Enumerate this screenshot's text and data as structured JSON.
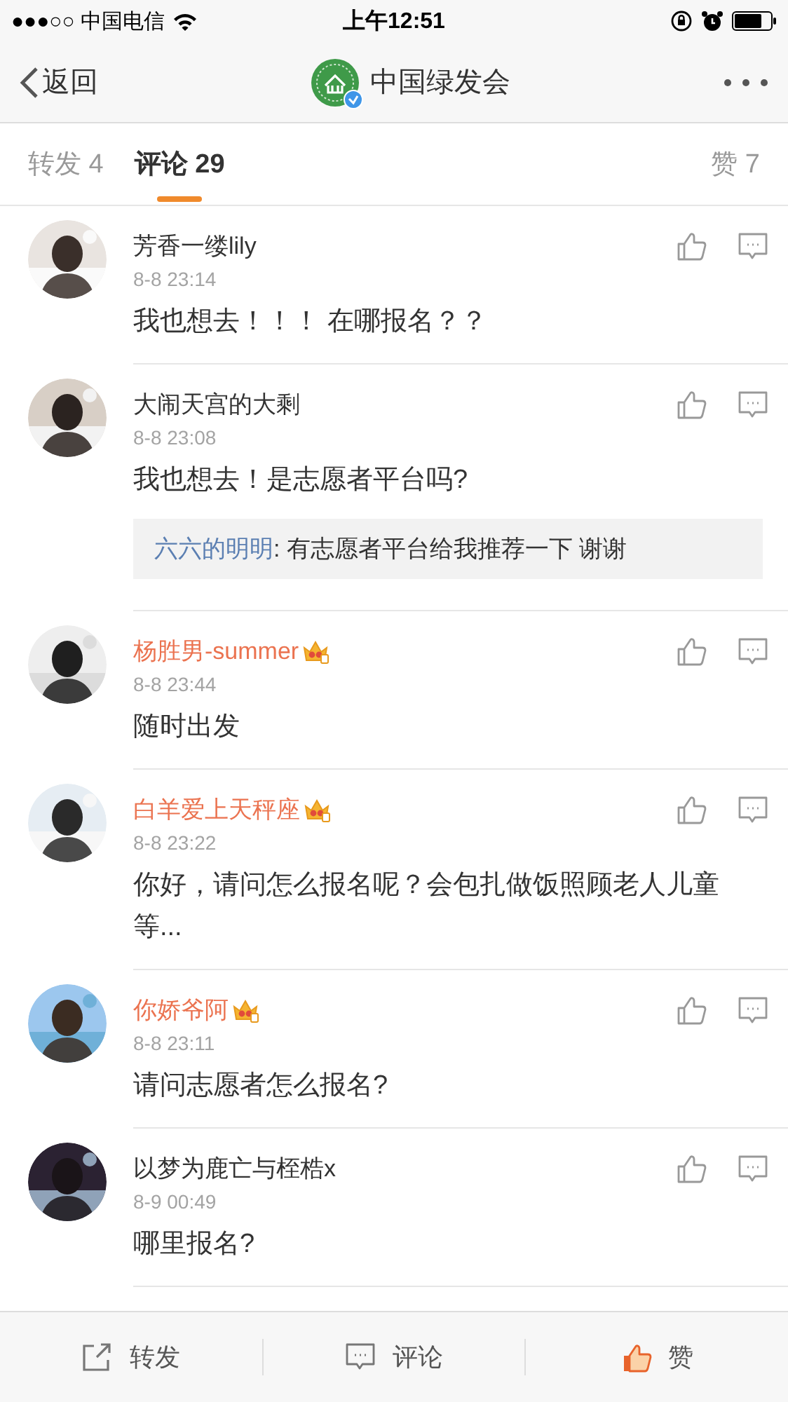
{
  "status_bar": {
    "carrier": "●●●○○ 中国电信",
    "time": "上午12:51"
  },
  "nav": {
    "back": "返回",
    "title": "中国绿发会",
    "verified": true
  },
  "tabs": [
    {
      "label": "转发 4",
      "selected": false
    },
    {
      "label": "评论 29",
      "selected": true
    },
    {
      "label": "赞 7",
      "selected": false
    }
  ],
  "comments": [
    {
      "author": "芳香一缕lily",
      "vip": false,
      "time": "8-8 23:14",
      "text": "我也想去！！！ 在哪报名？？"
    },
    {
      "author": "大闹天宫的大剩",
      "vip": false,
      "time": "8-8 23:08",
      "text": "我也想去！是志愿者平台吗?",
      "reply": {
        "author": "六六的明明",
        "text": ": 有志愿者平台给我推荐一下 谢谢"
      }
    },
    {
      "author": "杨胜男-summer",
      "vip": true,
      "time": "8-8 23:44",
      "text": "随时出发"
    },
    {
      "author": "白羊爱上天秤座",
      "vip": true,
      "time": "8-8 23:22",
      "text": "你好，请问怎么报名呢？会包扎做饭照顾老人儿童等..."
    },
    {
      "author": "你娇爷阿",
      "vip": true,
      "time": "8-8 23:11",
      "text": "请问志愿者怎么报名?"
    },
    {
      "author": "以梦为鹿亡与桎梏x",
      "vip": false,
      "time": "8-9 00:49",
      "text": "哪里报名?"
    }
  ],
  "bottom_bar": [
    {
      "kind": "repost",
      "label": "转发",
      "liked": false
    },
    {
      "kind": "comment",
      "label": "评论",
      "liked": false
    },
    {
      "kind": "like",
      "label": "赞",
      "liked": true
    }
  ]
}
